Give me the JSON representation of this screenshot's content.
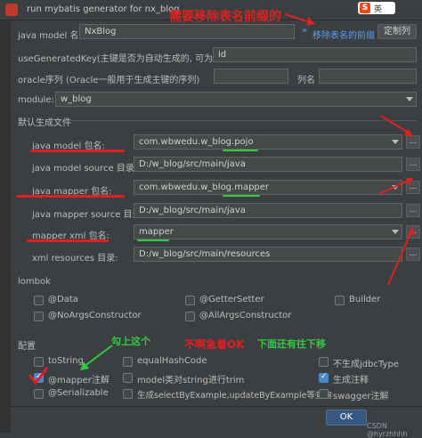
{
  "window": {
    "title": "run mybatis generator for nx_blog",
    "ime_label": "英",
    "ime_logo": "S"
  },
  "annotations": {
    "remove_prefix_note": "需要移除表名前缀的",
    "check_this": "勾上这个",
    "dont_rush_ok": "不啊急着OK",
    "scroll_down": "下面还有往下移"
  },
  "colors": {
    "annotation_red": "#e02020",
    "annotation_green": "#2ecc40",
    "accent_blue": "#365880"
  },
  "form": {
    "java_model_name_label": "java model 名:",
    "java_model_name_value": "NxBlog",
    "remove_prefix_link": "移除表名的前缀",
    "remove_prefix_icon": "»",
    "custom_columns_button": "定制列",
    "use_generated_key_label": "useGeneratedKey(主键是否为自动生成的, 可为空):",
    "use_generated_key_value": "id",
    "oracle_sequence_label": "oracle序列 (Oracle一般用于生成主键的序列)",
    "oracle_sequence_value": "",
    "column_name_label": "列名",
    "column_name_value": "",
    "module_label": "module:",
    "module_value": "w_blog",
    "default_files_section": "默认生成文件",
    "java_model_package_label": "java model 包名:",
    "java_model_package_value": "com.wbwedu.w_blog.pojo",
    "java_model_source_label": "java model source 目录:",
    "java_model_source_value": "D:/w_blog/src/main/java",
    "java_mapper_package_label": "java mapper 包名:",
    "java_mapper_package_value": "com.wbwedu.w_blog.mapper",
    "java_mapper_source_label": "java mapper source 目录:",
    "java_mapper_source_value": "D:/w_blog/src/main/java",
    "mapper_xml_package_label": "mapper xml 包名:",
    "mapper_xml_package_value": "mapper",
    "xml_resources_label": "xml resources 目录:",
    "xml_resources_value": "D:/w_blog/src/main/resources",
    "ellipsis_label": "..."
  },
  "lombok": {
    "section": "lombok",
    "options": [
      {
        "label": "@Data",
        "checked": false
      },
      {
        "label": "@GetterSetter",
        "checked": false
      },
      {
        "label": "Builder",
        "checked": false
      },
      {
        "label": "@NoArgsConstructor",
        "checked": false
      },
      {
        "label": "@AllArgsConstructor",
        "checked": false
      }
    ]
  },
  "config": {
    "section": "配置",
    "options": [
      {
        "label": "toString",
        "checked": false
      },
      {
        "label": "equalHashCode",
        "checked": false
      },
      {
        "label": "不生成jdbcType",
        "checked": false
      },
      {
        "label": "@mapper注解",
        "checked": true
      },
      {
        "label": "model类对string进行trim",
        "checked": false
      },
      {
        "label": "生成注释",
        "checked": true
      },
      {
        "label": "@Serializable",
        "checked": false
      },
      {
        "label": "生成selectByExample,updateByExample等查询",
        "checked": false
      },
      {
        "label": "swagger注解",
        "checked": false
      }
    ]
  },
  "footer": {
    "ok_label": "OK",
    "watermark": "CSDN @hyrzhhhh"
  }
}
